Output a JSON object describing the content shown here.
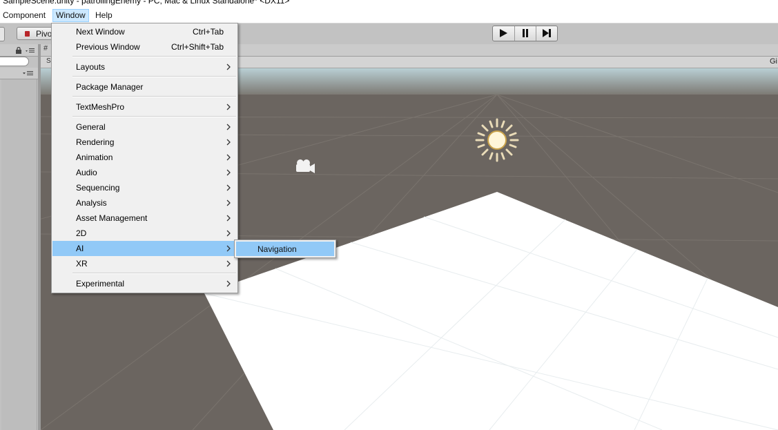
{
  "window": {
    "title": "SampleScene.unity - patrollingEnemy - PC, Mac & Linux Standalone* <DX11>"
  },
  "menubar": {
    "items": [
      {
        "label": "Component",
        "active": false
      },
      {
        "label": "Window",
        "active": true
      },
      {
        "label": "Help",
        "active": false
      }
    ]
  },
  "toolbar": {
    "pivot_label": "Pivot",
    "play_controls": [
      "play",
      "pause",
      "step"
    ]
  },
  "window_menu": {
    "next_window": {
      "label": "Next Window",
      "shortcut": "Ctrl+Tab"
    },
    "previous_window": {
      "label": "Previous Window",
      "shortcut": "Ctrl+Shift+Tab"
    },
    "layouts": {
      "label": "Layouts"
    },
    "package_manager": {
      "label": "Package Manager"
    },
    "textmeshpro": {
      "label": "TextMeshPro"
    },
    "general": {
      "label": "General"
    },
    "rendering": {
      "label": "Rendering"
    },
    "animation": {
      "label": "Animation"
    },
    "audio": {
      "label": "Audio"
    },
    "sequencing": {
      "label": "Sequencing"
    },
    "analysis": {
      "label": "Analysis"
    },
    "asset_management": {
      "label": "Asset Management"
    },
    "two_d": {
      "label": "2D"
    },
    "ai": {
      "label": "AI"
    },
    "xr": {
      "label": "XR"
    },
    "experimental": {
      "label": "Experimental"
    }
  },
  "ai_submenu": {
    "navigation": {
      "label": "Navigation"
    }
  },
  "scene": {
    "sky_color": "#b9cfd4",
    "ground_color": "#6b6560",
    "plane_color": "#ffffff",
    "gizmos_label": "Gi"
  },
  "colors": {
    "menu_highlight": "#91c9f7",
    "menubar_active": "#cce8ff"
  }
}
